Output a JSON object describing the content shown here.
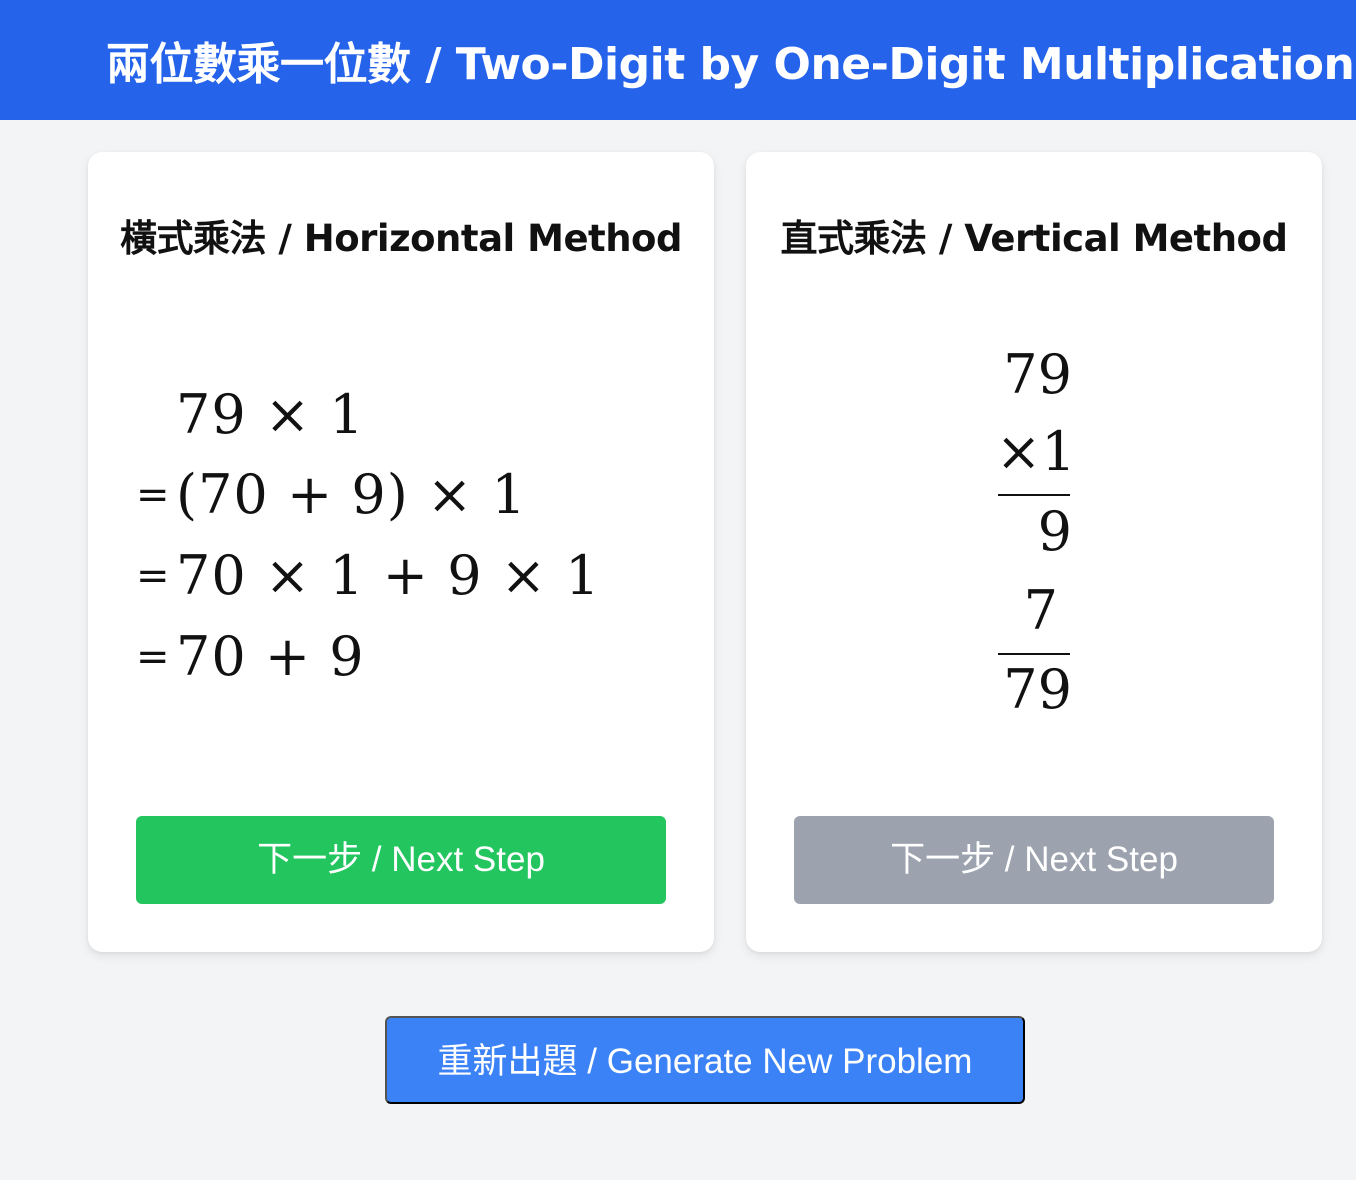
{
  "header": {
    "title": "兩位數乘一位數 / Two-Digit by One-Digit Multiplication"
  },
  "horizontal": {
    "title": "橫式乘法 / Horizontal Method",
    "lines": [
      {
        "prefix": "",
        "expr": "79 × 1"
      },
      {
        "prefix": "=",
        "expr": "(70 + 9) × 1"
      },
      {
        "prefix": "=",
        "expr": "70 × 1 + 9 × 1"
      },
      {
        "prefix": "=",
        "expr": "70 + 9"
      }
    ],
    "next_label": "下一步 / Next Step"
  },
  "vertical": {
    "title": "直式乘法 / Vertical Method",
    "multiplicand": "79",
    "multiplier": "×1",
    "partial_ones": "9",
    "partial_tens": "7",
    "result": "79",
    "next_label": "下一步 / Next Step"
  },
  "actions": {
    "new_problem_label": "重新出題 / Generate New Problem"
  },
  "colors": {
    "header_bg": "#2563eb",
    "next_active": "#22c55e",
    "next_disabled": "#9ca3af",
    "new_problem": "#3b82f6",
    "page_bg": "#f3f4f6"
  }
}
